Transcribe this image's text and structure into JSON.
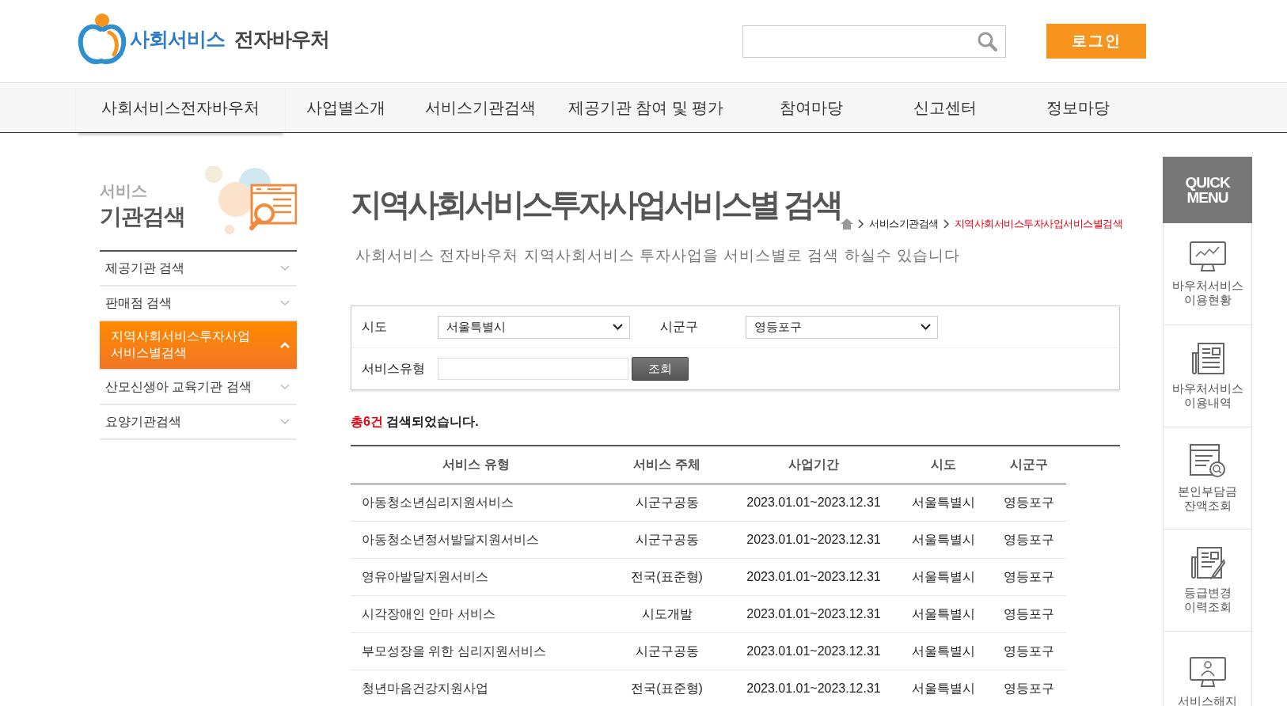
{
  "header": {
    "logo": {
      "primary": "사회서비스",
      "secondary": "전자바우처"
    },
    "login_button": "로그인"
  },
  "nav": [
    {
      "label": "사회서비스전자바우처",
      "selected": true
    },
    {
      "label": "사업별소개",
      "selected": false
    },
    {
      "label": "서비스기관검색",
      "selected": false
    },
    {
      "label": "제공기관 참여 및 평가",
      "selected": false
    },
    {
      "label": "참여마당",
      "selected": false
    },
    {
      "label": "신고센터",
      "selected": false
    },
    {
      "label": "정보마당",
      "selected": false
    }
  ],
  "sidebar": {
    "heading_small": "서비스",
    "heading": "기관검색",
    "items": [
      {
        "label": "제공기관 검색",
        "selected": false,
        "expanded": false
      },
      {
        "label": "판매점 검색",
        "selected": false,
        "expanded": false
      },
      {
        "label": "지역사회서비스투자사업 서비스별검색",
        "selected": true,
        "expanded": true
      },
      {
        "label": "산모신생아 교육기관 검색",
        "selected": false,
        "expanded": false
      },
      {
        "label": "요양기관검색",
        "selected": false,
        "expanded": false
      }
    ]
  },
  "page": {
    "title": "지역사회서비스투자사업서비스별 검색",
    "breadcrumb": [
      {
        "label": "서비스기관검색",
        "current": false
      },
      {
        "label": "지역사회서비스투자사업서비스별검색",
        "current": true
      }
    ],
    "description": "사회서비스 전자바우처 지역사회서비스 투자사업을 서비스별로 검색 하실수 있습니다"
  },
  "search_form": {
    "sido": {
      "label": "시도",
      "value": "서울특별시"
    },
    "sigungu": {
      "label": "시군구",
      "value": "영등포구"
    },
    "service_type": {
      "label": "서비스유형"
    },
    "button": "조회"
  },
  "result": {
    "count": "총6건",
    "text": "검색되었습니다."
  },
  "table": {
    "columns": [
      "서비스 유형",
      "서비스 주체",
      "사업기간",
      "시도",
      "시군구"
    ],
    "rows": [
      [
        "아동청소년심리지원서비스",
        "시군구공동",
        "2023.01.01~2023.12.31",
        "서울특별시",
        "영등포구"
      ],
      [
        "아동청소년정서발달지원서비스",
        "시군구공동",
        "2023.01.01~2023.12.31",
        "서울특별시",
        "영등포구"
      ],
      [
        "영유아발달지원서비스",
        "전국(표준형)",
        "2023.01.01~2023.12.31",
        "서울특별시",
        "영등포구"
      ],
      [
        "시각장애인 안마 서비스",
        "시도개발",
        "2023.01.01~2023.12.31",
        "서울특별시",
        "영등포구"
      ],
      [
        "부모성장을 위한 심리지원서비스",
        "시군구공동",
        "2023.01.01~2023.12.31",
        "서울특별시",
        "영등포구"
      ],
      [
        "청년마음건강지원사업",
        "전국(표준형)",
        "2023.01.01~2023.12.31",
        "서울특별시",
        "영등포구"
      ]
    ]
  },
  "quick_menu": {
    "title_lines": [
      "QUICK",
      "MENU"
    ],
    "items": [
      {
        "lines": [
          "바우처서비스",
          "이용현황"
        ]
      },
      {
        "lines": [
          "바우처서비스",
          "이용내역"
        ]
      },
      {
        "lines": [
          "본인부담금",
          "잔액조회"
        ]
      },
      {
        "lines": [
          "등급변경",
          "이력조회"
        ]
      },
      {
        "lines": [
          "서비스해지"
        ]
      }
    ]
  }
}
